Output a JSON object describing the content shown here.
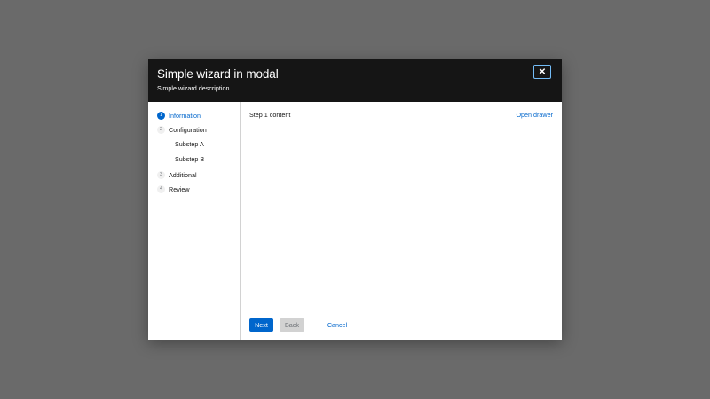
{
  "modal": {
    "title": "Simple wizard in modal",
    "description": "Simple wizard description",
    "close_symbol": "✕"
  },
  "nav": {
    "steps": [
      {
        "number": "1",
        "label": "Information",
        "current": true
      },
      {
        "number": "2",
        "label": "Configuration",
        "current": false
      },
      {
        "number": "3",
        "label": "Additional",
        "current": false
      },
      {
        "number": "4",
        "label": "Review",
        "current": false
      }
    ],
    "substeps": [
      "Substep A",
      "Substep B"
    ]
  },
  "content": {
    "text": "Step 1 content",
    "drawer_link": "Open drawer"
  },
  "footer": {
    "next_label": "Next",
    "back_label": "Back",
    "cancel_label": "Cancel"
  },
  "colors": {
    "backdrop": "#6a6a6a",
    "header": "#151515",
    "accent": "#0066cc",
    "focus_ring": "#73bcf7",
    "disabled": "#d2d2d2"
  },
  "icons": {
    "close": "close-icon"
  }
}
